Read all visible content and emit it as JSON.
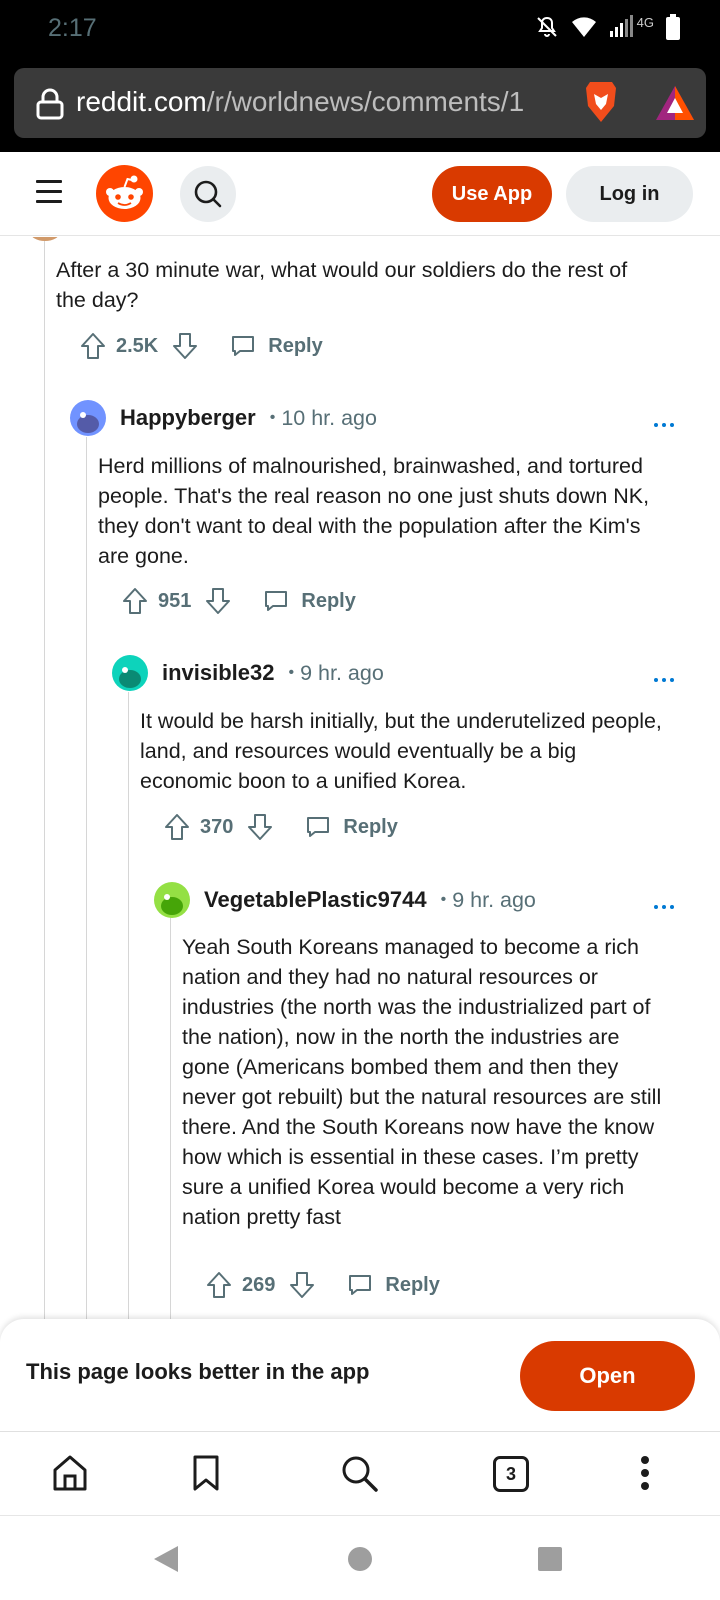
{
  "status_bar": {
    "time": "2:17",
    "network": "4G"
  },
  "browser": {
    "url_domain": "reddit.com",
    "url_path": "/r/worldnews/comments/1"
  },
  "header": {
    "use_app_label": "Use App",
    "login_label": "Log in"
  },
  "comments": [
    {
      "body": "After a 30 minute war, what would our soldiers do the rest of the day?",
      "score": "2.5K",
      "reply_label": "Reply"
    },
    {
      "author": "Happyberger",
      "separator": "•",
      "time": "10 hr. ago",
      "body": "Herd millions of malnourished, brainwashed, and tortured people. That's the real reason no one just shuts down NK, they don't want to deal with the population after the Kim's are gone.",
      "score": "951",
      "reply_label": "Reply",
      "avatar_color": "#7193ff"
    },
    {
      "author": "invisible32",
      "separator": "•",
      "time": "9 hr. ago",
      "body": "It would be harsh initially, but the underutelized people, land, and resources would eventually be a big economic boon to a unified Korea.",
      "score": "370",
      "reply_label": "Reply",
      "avatar_color": "#0dd3bb"
    },
    {
      "author": "VegetablePlastic9744",
      "separator": "•",
      "time": "9 hr. ago",
      "body": "Yeah South Koreans managed to become a rich nation and they had no natural resources or industries (the north was the industrialized part of the nation), now in the north the industries are gone (Americans bombed them and then they never got rebuilt) but the natural resources are still there. And the South Koreans now have the know how which is essential in these cases. I’m pretty sure a unified Korea would become a very rich nation pretty fast",
      "score": "269",
      "reply_label": "Reply",
      "avatar_color": "#94e044"
    }
  ],
  "app_prompt": {
    "message": "This page looks better in the app",
    "open_label": "Open"
  },
  "bottom_bar": {
    "tab_count": "3"
  },
  "colors": {
    "accent": "#d93a00",
    "reddit": "#ff4500",
    "link_blue": "#0079d3",
    "meta_gray": "#576f76"
  }
}
